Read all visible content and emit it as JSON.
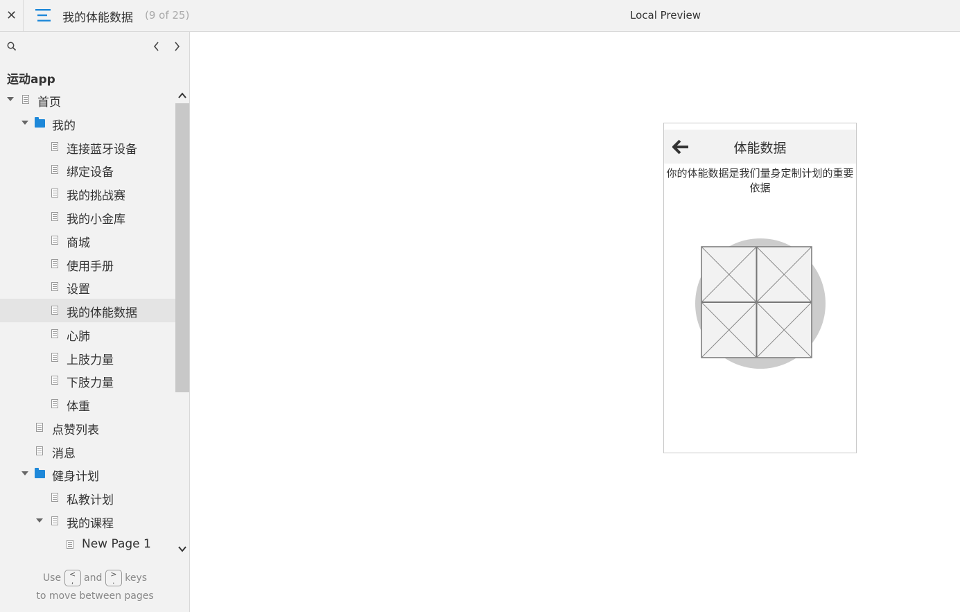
{
  "topbar": {
    "close_label": "✕",
    "page_title": "我的体能数据",
    "page_count": "(9 of 25)",
    "preview_label": "Local Preview"
  },
  "sidebar": {
    "project_title": "运动app",
    "items": [
      {
        "label": "首页",
        "type": "page",
        "level": 0,
        "expanded": true
      },
      {
        "label": "我的",
        "type": "folder",
        "level": 1,
        "expanded": true
      },
      {
        "label": "连接蓝牙设备",
        "type": "page",
        "level": 2
      },
      {
        "label": "绑定设备",
        "type": "page",
        "level": 2
      },
      {
        "label": "我的挑战赛",
        "type": "page",
        "level": 2
      },
      {
        "label": "我的小金库",
        "type": "page",
        "level": 2
      },
      {
        "label": "商城",
        "type": "page",
        "level": 2
      },
      {
        "label": "使用手册",
        "type": "page",
        "level": 2
      },
      {
        "label": "设置",
        "type": "page",
        "level": 2
      },
      {
        "label": "我的体能数据",
        "type": "page",
        "level": 2,
        "selected": true
      },
      {
        "label": "心肺",
        "type": "page",
        "level": 2
      },
      {
        "label": "上肢力量",
        "type": "page",
        "level": 2
      },
      {
        "label": "下肢力量",
        "type": "page",
        "level": 2
      },
      {
        "label": "体重",
        "type": "page",
        "level": 2
      },
      {
        "label": "点赞列表",
        "type": "page",
        "level": 1
      },
      {
        "label": "消息",
        "type": "page",
        "level": 1
      },
      {
        "label": "健身计划",
        "type": "folder",
        "level": 1,
        "expanded": true
      },
      {
        "label": "私教计划",
        "type": "page",
        "level": 2
      },
      {
        "label": "我的课程",
        "type": "page",
        "level": 2,
        "expanded": true
      },
      {
        "label": "New Page 1",
        "type": "page",
        "level": 3
      }
    ],
    "hint": {
      "use": "Use",
      "key_prev": "<\n,",
      "and": "and",
      "key_next": ">\n.",
      "keys": "keys",
      "line2": "to move between pages"
    }
  },
  "preview": {
    "title": "体能数据",
    "description": "你的体能数据是我们量身定制计划的重要依据"
  },
  "colors": {
    "accent": "#1e88d9",
    "sidebar_bg": "#f2f2f2",
    "selected_bg": "#e4e4e4",
    "scroll_thumb": "#c8c8c8"
  }
}
